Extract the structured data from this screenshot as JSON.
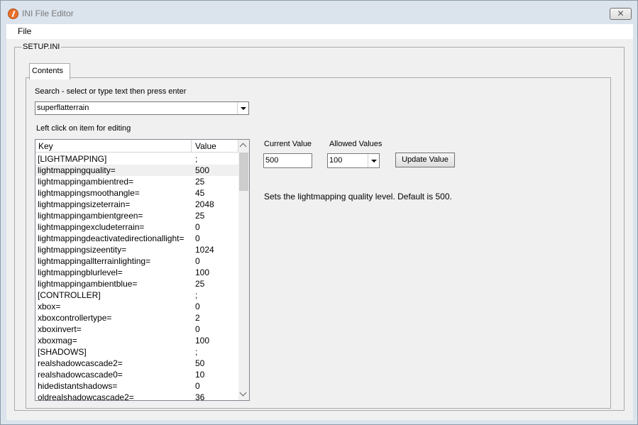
{
  "window": {
    "title": "INI File Editor",
    "close_glyph": "✕"
  },
  "menu": {
    "file": "File"
  },
  "group": {
    "title": "SETUP.INI"
  },
  "tabs": [
    {
      "label": "Contents"
    }
  ],
  "search": {
    "label": "Search - select or type text then press enter",
    "value": "superflatterrain"
  },
  "list": {
    "label": "Left click on item for editing",
    "columns": {
      "key": "Key",
      "value": "Value"
    },
    "selected_index": 1,
    "rows": [
      {
        "key": "[LIGHTMAPPING]",
        "value": ";"
      },
      {
        "key": "lightmappingquality=",
        "value": "500"
      },
      {
        "key": "lightmappingambientred=",
        "value": "25"
      },
      {
        "key": "lightmappingsmoothangle=",
        "value": "45"
      },
      {
        "key": "lightmappingsizeterrain=",
        "value": "2048"
      },
      {
        "key": "lightmappingambientgreen=",
        "value": "25"
      },
      {
        "key": "lightmappingexcludeterrain=",
        "value": "0"
      },
      {
        "key": "lightmappingdeactivatedirectionallight=",
        "value": "0"
      },
      {
        "key": "lightmappingsizeentity=",
        "value": "1024"
      },
      {
        "key": "lightmappingallterrainlighting=",
        "value": "0"
      },
      {
        "key": "lightmappingblurlevel=",
        "value": "100"
      },
      {
        "key": "lightmappingambientblue=",
        "value": "25"
      },
      {
        "key": "[CONTROLLER]",
        "value": ";"
      },
      {
        "key": "xbox=",
        "value": "0"
      },
      {
        "key": "xboxcontrollertype=",
        "value": "2"
      },
      {
        "key": "xboxinvert=",
        "value": "0"
      },
      {
        "key": "xboxmag=",
        "value": "100"
      },
      {
        "key": "[SHADOWS]",
        "value": ";"
      },
      {
        "key": "realshadowcascade2=",
        "value": "50"
      },
      {
        "key": "realshadowcascade0=",
        "value": "10"
      },
      {
        "key": "hidedistantshadows=",
        "value": "0"
      },
      {
        "key": "oldrealshadowcascade2=",
        "value": "36"
      }
    ]
  },
  "editor": {
    "current_label": "Current Value",
    "current_value": "500",
    "allowed_label": "Allowed Values",
    "allowed_value": "100",
    "update_button": "Update Value",
    "description": "Sets the lightmapping quality level. Default is 500."
  },
  "icons": {
    "app": "app-icon",
    "close": "close-icon",
    "dropdown": "chevron-down-icon",
    "scroll_up": "chevron-up-icon",
    "scroll_down": "chevron-down-icon"
  }
}
